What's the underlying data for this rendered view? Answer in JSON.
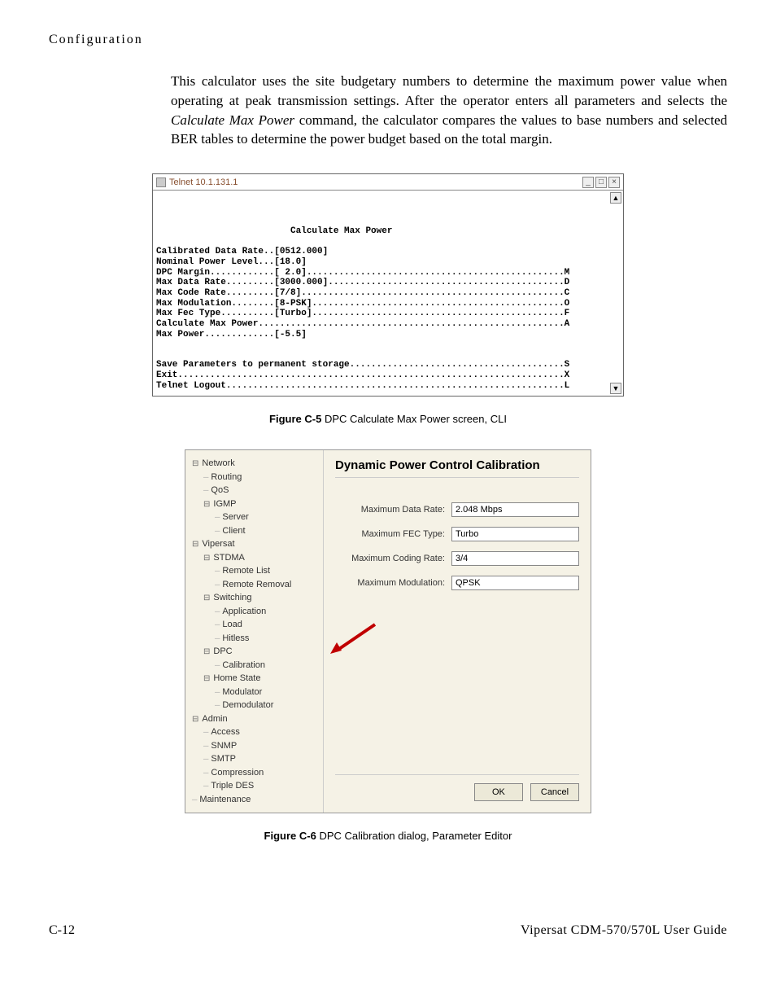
{
  "header": "Configuration",
  "paragraph_parts": {
    "p1": "This calculator uses the site budgetary numbers to determine the maximum power value when operating at peak transmission settings. After the operator enters all parameters and selects the ",
    "p2": "Calculate Max Power",
    "p3": " command, the calculator compares the values to base numbers and selected BER tables to determine the power budget based on the total margin."
  },
  "term": {
    "title": "Telnet 10.1.131.1",
    "minimize": "_",
    "restore": "□",
    "close": "×",
    "scroll_up": "▲",
    "scroll_down": "▼",
    "text": "\n\n\n                         Calculate Max Power\n\nCalibrated Data Rate..[0512.000]\nNominal Power Level...[18.0]\nDPC Margin............[ 2.0]................................................M\nMax Data Rate.........[3000.000]............................................D\nMax Code Rate.........[7/8].................................................C\nMax Modulation........[8-PSK]...............................................O\nMax Fec Type..........[Turbo]...............................................F\nCalculate Max Power.........................................................A\nMax Power.............[-5.5]\n\n\nSave Parameters to permanent storage........................................S\nExit........................................................................X\nTelnet Logout...............................................................L"
  },
  "fig_c5": {
    "label": "Figure C-5",
    "text": "   DPC Calculate Max Power screen, CLI"
  },
  "tree": [
    {
      "cls": "n0 exp",
      "t": "Network"
    },
    {
      "cls": "n1 leaf",
      "t": "Routing"
    },
    {
      "cls": "n1 leaf",
      "t": "QoS"
    },
    {
      "cls": "n1 exp",
      "t": "IGMP"
    },
    {
      "cls": "n2 leaf",
      "t": "Server"
    },
    {
      "cls": "n2 leaf",
      "t": "Client"
    },
    {
      "cls": "n0 exp",
      "t": "Vipersat"
    },
    {
      "cls": "n1 exp",
      "t": "STDMA"
    },
    {
      "cls": "n2 leaf",
      "t": "Remote List"
    },
    {
      "cls": "n2 leaf",
      "t": "Remote Removal"
    },
    {
      "cls": "n1 exp",
      "t": "Switching"
    },
    {
      "cls": "n2 leaf",
      "t": "Application"
    },
    {
      "cls": "n2 leaf",
      "t": "Load"
    },
    {
      "cls": "n2 leaf",
      "t": "Hitless"
    },
    {
      "cls": "n1 exp",
      "t": "DPC"
    },
    {
      "cls": "n2 leaf sel",
      "t": "Calibration"
    },
    {
      "cls": "n1 exp",
      "t": "Home State"
    },
    {
      "cls": "n2 leaf",
      "t": "Modulator"
    },
    {
      "cls": "n2 leaf",
      "t": "Demodulator"
    },
    {
      "cls": "n0 exp",
      "t": "Admin"
    },
    {
      "cls": "n1 leaf",
      "t": "Access"
    },
    {
      "cls": "n1 leaf",
      "t": "SNMP"
    },
    {
      "cls": "n1 leaf",
      "t": "SMTP"
    },
    {
      "cls": "n1 leaf",
      "t": "Compression"
    },
    {
      "cls": "n1 leaf",
      "t": "Triple DES"
    },
    {
      "cls": "n0 leaf",
      "t": "Maintenance"
    }
  ],
  "dialog": {
    "title": "Dynamic Power Control Calibration",
    "rows": [
      {
        "label": "Maximum Data Rate:",
        "value": "2.048 Mbps"
      },
      {
        "label": "Maximum FEC Type:",
        "value": "Turbo"
      },
      {
        "label": "Maximum Coding Rate:",
        "value": "3/4"
      },
      {
        "label": "Maximum Modulation:",
        "value": "QPSK"
      }
    ],
    "ok": "OK",
    "cancel": "Cancel"
  },
  "fig_c6": {
    "label": "Figure C-6",
    "text": "   DPC Calibration dialog, Parameter Editor"
  },
  "footer": {
    "left": "C-12",
    "right": "Vipersat CDM-570/570L User Guide"
  }
}
